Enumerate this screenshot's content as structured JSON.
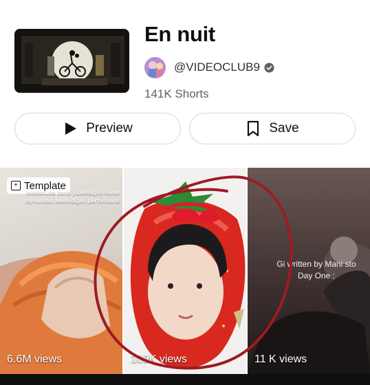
{
  "playlist": {
    "title": "En nuit",
    "channel_handle": "@VIDEOCLUB9",
    "shorts_count": "141K Shorts"
  },
  "actions": {
    "preview_label": "Preview",
    "save_label": "Save"
  },
  "shorts": [
    {
      "views": "6.6M views",
      "badge": "Template",
      "caption": "telefonuna zorla yüklediğim slime oynundan beklediğim performans"
    },
    {
      "views": "109K views"
    },
    {
      "views": "11 K views",
      "caption": "Gi   written by Mani   sto Day One :"
    }
  ],
  "colors": {
    "annotation": "#9e1b22",
    "accent_red": "#d9281f"
  }
}
